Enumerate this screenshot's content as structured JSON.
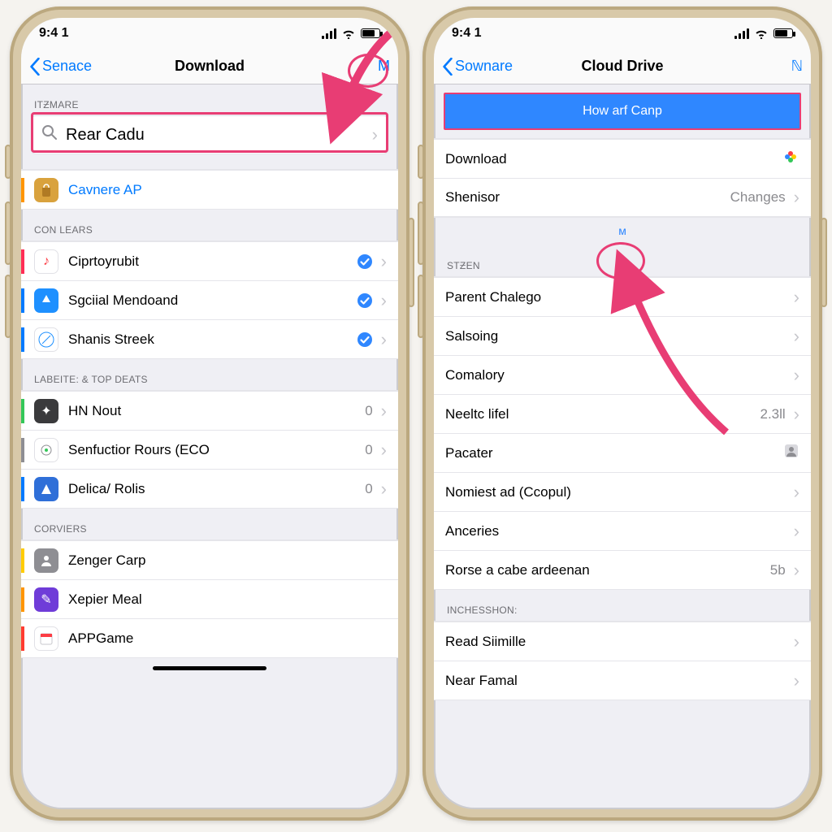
{
  "phone1": {
    "status_time": "9:4 1",
    "nav": {
      "back": "Senace",
      "title": "Download",
      "action": "M"
    },
    "section1_header": "ITƵMARE",
    "search_text": "Rear Cadu",
    "row_cavnere": "Cavnere AP",
    "section2_header": "CON LEARS",
    "rows2": [
      {
        "label": "Ciprtoyrubit"
      },
      {
        "label": "Sgciial Mendoand"
      },
      {
        "label": "Shanis Streek"
      }
    ],
    "section3_header": "LABEITE: & TOP DEATS",
    "rows3": [
      {
        "label": "HN Nout",
        "value": "0"
      },
      {
        "label": "Senfuctior Rours (ECO",
        "value": "0"
      },
      {
        "label": "Delica/ Rolis",
        "value": "0"
      }
    ],
    "section4_header": "CORVIERS",
    "rows4": [
      {
        "label": "Zenger Carp"
      },
      {
        "label": "Xepier Meal"
      },
      {
        "label": "APPGame"
      }
    ]
  },
  "phone2": {
    "status_time": "9:4 1",
    "nav": {
      "back": "Sownare",
      "title": "Cloud Drive",
      "action": "ℕ"
    },
    "bluebar": "How arf Canp",
    "rows_top": [
      {
        "label": "Download"
      },
      {
        "label": "Shenisor",
        "value": "Changes"
      }
    ],
    "mid_badge": "ᴍ",
    "section_sten": "STƵEN",
    "rows_sten": [
      {
        "label": "Parent Chalego"
      },
      {
        "label": "Salsoing"
      },
      {
        "label": "Comalory"
      },
      {
        "label": "Neeltc lifel",
        "value": "2.3ll"
      },
      {
        "label": "Pacater"
      },
      {
        "label": "Nomiest ad (Ccopul)"
      },
      {
        "label": "Anceries"
      },
      {
        "label": "Rorse a cabe ardeenan",
        "value": "5b"
      }
    ],
    "section_inc": "INCHESSHON:",
    "rows_inc": [
      {
        "label": "Read Siimille"
      },
      {
        "label": "Near Famal"
      }
    ]
  }
}
